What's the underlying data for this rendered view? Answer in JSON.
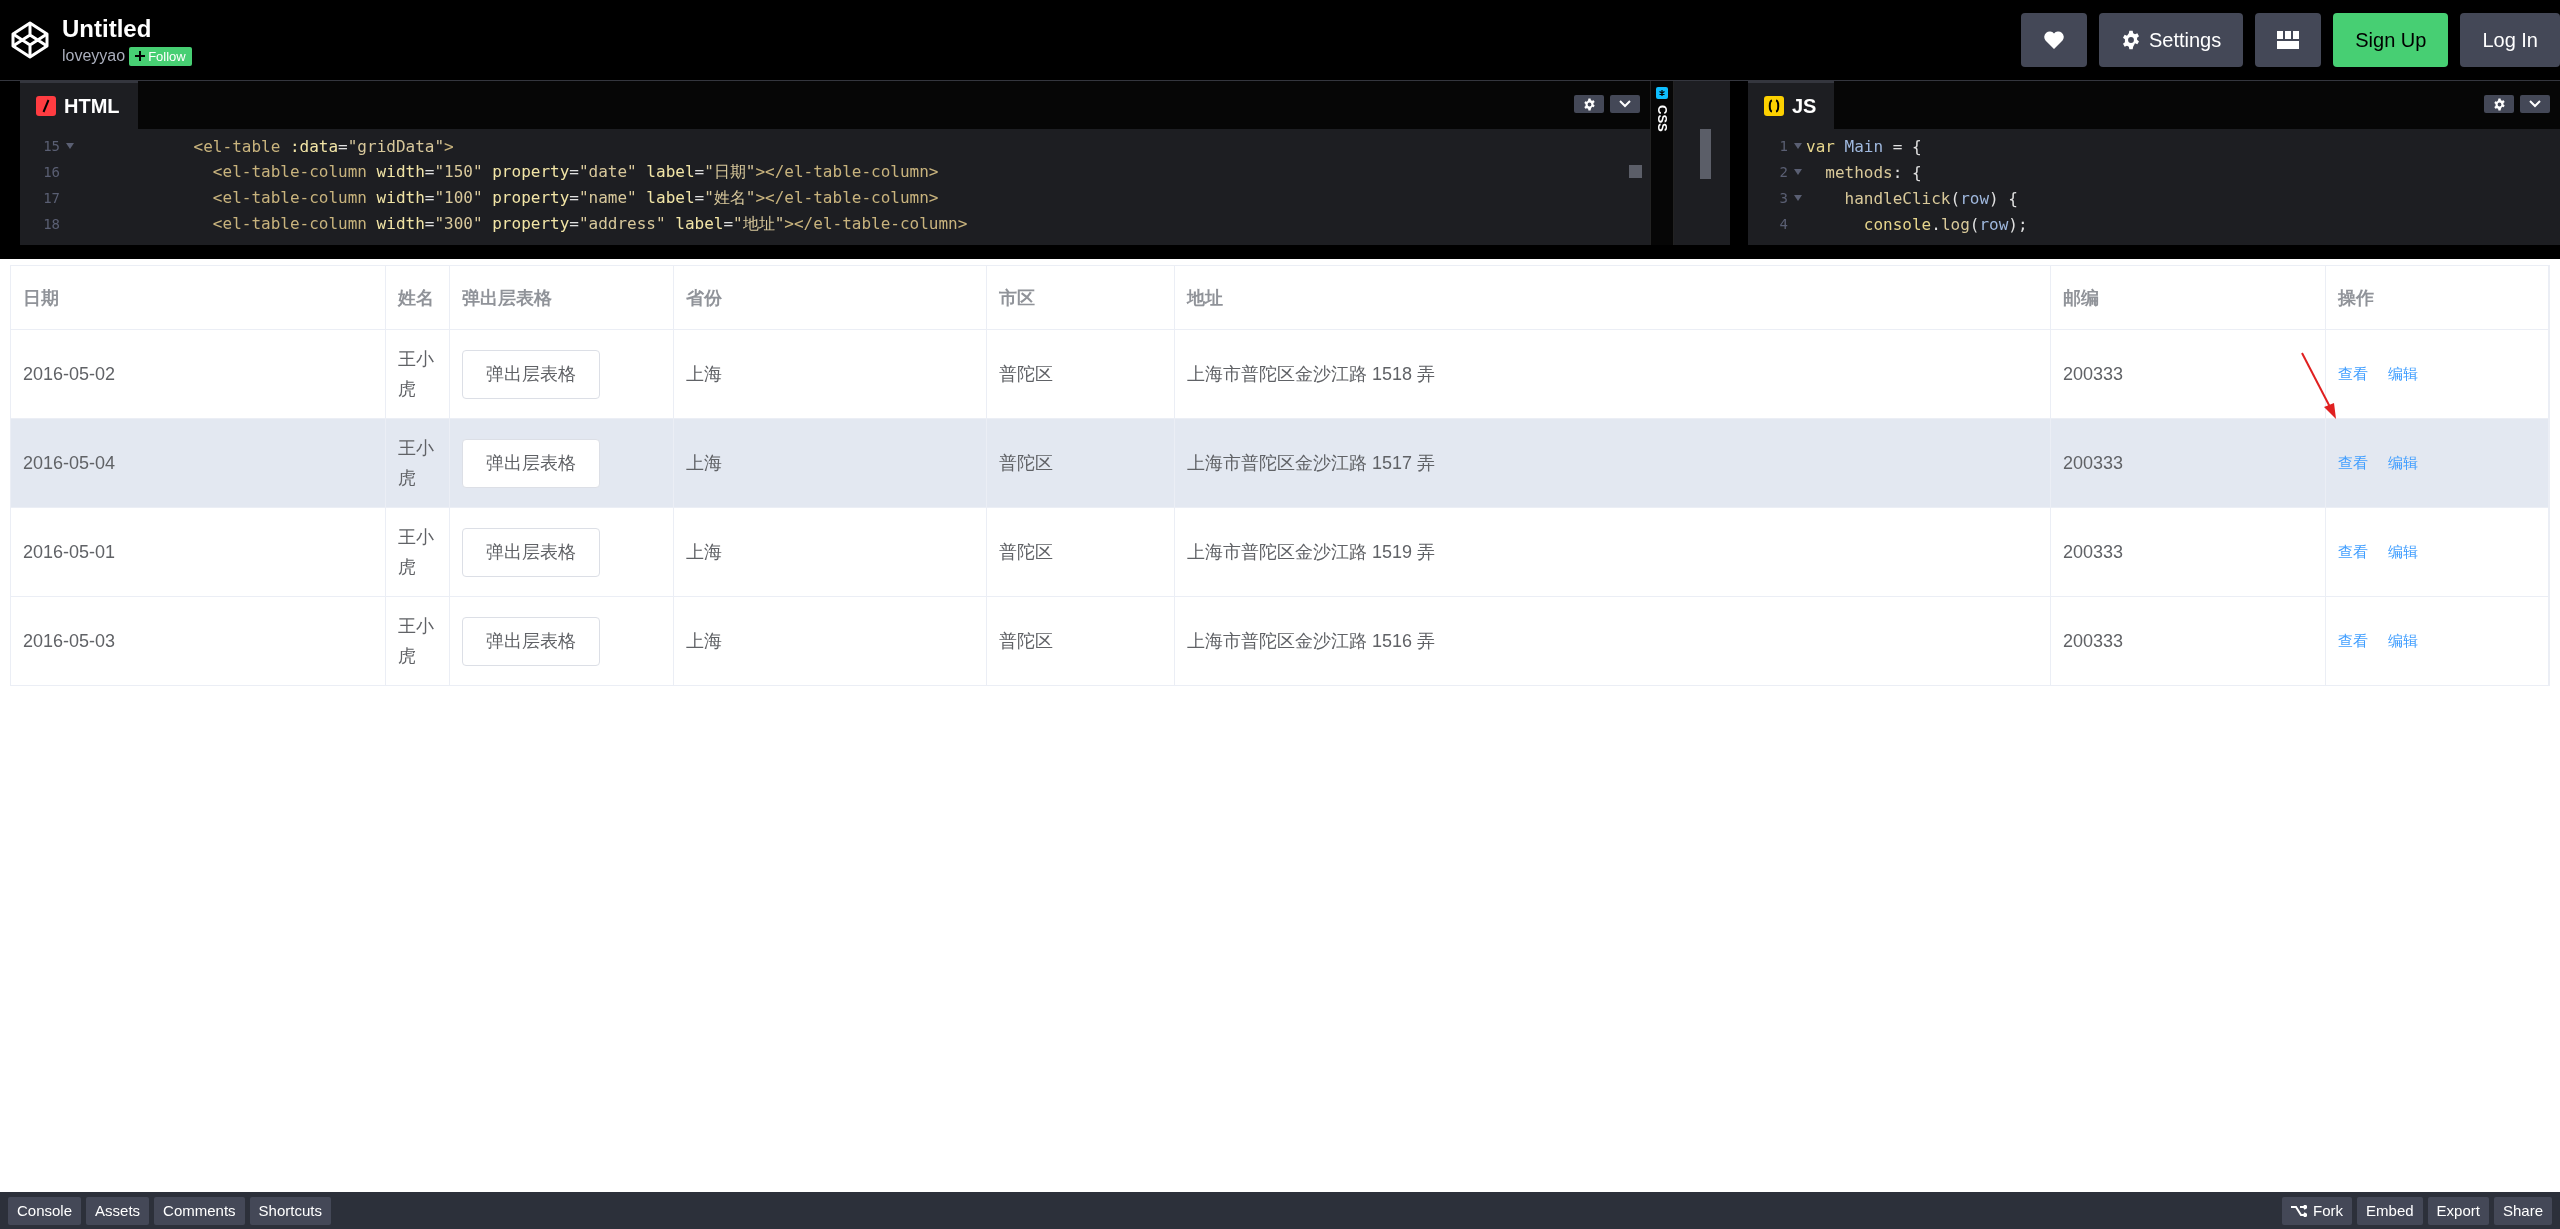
{
  "header": {
    "title": "Untitled",
    "author": "loveyyao",
    "follow_button": "Follow",
    "actions": [
      {
        "kind": "heart"
      },
      {
        "kind": "settings",
        "label": "Settings"
      },
      {
        "kind": "layout"
      },
      {
        "kind": "primary",
        "label": "Sign Up"
      },
      {
        "kind": "plain",
        "label": "Log In"
      }
    ]
  },
  "editors": {
    "html": {
      "tab": "HTML",
      "lines": [
        {
          "number": "15",
          "fold": true,
          "tokens": [
            {
              "kind": "tag",
              "text": "            <el-table"
            },
            {
              "kind": "attr",
              "text": " :data"
            },
            {
              "kind": "plain",
              "text": "="
            },
            {
              "kind": "str",
              "text": "\"gridData\""
            },
            {
              "kind": "tag",
              "text": ">"
            }
          ]
        },
        {
          "number": "16",
          "fold": false,
          "tokens": [
            {
              "kind": "tag",
              "text": "              <el-table-column"
            },
            {
              "kind": "attr",
              "text": " width"
            },
            {
              "kind": "plain",
              "text": "="
            },
            {
              "kind": "str",
              "text": "\"150\""
            },
            {
              "kind": "attr",
              "text": " property"
            },
            {
              "kind": "plain",
              "text": "="
            },
            {
              "kind": "str",
              "text": "\"date\""
            },
            {
              "kind": "attr",
              "text": " label"
            },
            {
              "kind": "plain",
              "text": "="
            },
            {
              "kind": "str",
              "text": "\"日期\""
            },
            {
              "kind": "tag",
              "text": "></el-table-column>"
            }
          ]
        },
        {
          "number": "17",
          "fold": false,
          "tokens": [
            {
              "kind": "tag",
              "text": "              <el-table-column"
            },
            {
              "kind": "attr",
              "text": " width"
            },
            {
              "kind": "plain",
              "text": "="
            },
            {
              "kind": "str",
              "text": "\"100\""
            },
            {
              "kind": "attr",
              "text": " property"
            },
            {
              "kind": "plain",
              "text": "="
            },
            {
              "kind": "str",
              "text": "\"name\""
            },
            {
              "kind": "attr",
              "text": " label"
            },
            {
              "kind": "plain",
              "text": "="
            },
            {
              "kind": "str",
              "text": "\"姓名\""
            },
            {
              "kind": "tag",
              "text": "></el-table-column>"
            }
          ]
        },
        {
          "number": "18",
          "fold": false,
          "tokens": [
            {
              "kind": "tag",
              "text": "              <el-table-column"
            },
            {
              "kind": "attr",
              "text": " width"
            },
            {
              "kind": "plain",
              "text": "="
            },
            {
              "kind": "str",
              "text": "\"300\""
            },
            {
              "kind": "attr",
              "text": " property"
            },
            {
              "kind": "plain",
              "text": "="
            },
            {
              "kind": "str",
              "text": "\"address\""
            },
            {
              "kind": "attr",
              "text": " label"
            },
            {
              "kind": "plain",
              "text": "="
            },
            {
              "kind": "str",
              "text": "\"地址\""
            },
            {
              "kind": "tag",
              "text": "></el-table-column>"
            }
          ]
        }
      ]
    },
    "css": {
      "tab": "CSS"
    },
    "js": {
      "tab": "JS",
      "lines": [
        {
          "number": "1",
          "fold": true,
          "tokens": [
            {
              "kind": "keyword",
              "text": "var"
            },
            {
              "kind": "name",
              "text": " Main"
            },
            {
              "kind": "plain",
              "text": " = {"
            }
          ]
        },
        {
          "number": "2",
          "fold": true,
          "tokens": [
            {
              "kind": "prop",
              "text": "  methods"
            },
            {
              "kind": "plain",
              "text": ": {"
            }
          ]
        },
        {
          "number": "3",
          "fold": true,
          "tokens": [
            {
              "kind": "prop",
              "text": "    handleClick"
            },
            {
              "kind": "plain",
              "text": "("
            },
            {
              "kind": "name",
              "text": "row"
            },
            {
              "kind": "plain",
              "text": ") {"
            }
          ]
        },
        {
          "number": "4",
          "fold": false,
          "tokens": [
            {
              "kind": "keyword",
              "text": "      console"
            },
            {
              "kind": "plain",
              "text": "."
            },
            {
              "kind": "prop",
              "text": "log"
            },
            {
              "kind": "plain",
              "text": "("
            },
            {
              "kind": "name",
              "text": "row"
            },
            {
              "kind": "plain",
              "text": ");"
            }
          ]
        }
      ]
    }
  },
  "table": {
    "columns": [
      "日期",
      "姓名",
      "弹出层表格",
      "省份",
      "市区",
      "地址",
      "邮编",
      "操作"
    ],
    "rows": [
      {
        "date": "2016-05-02",
        "name": "王小虎",
        "popup_button": "弹出层表格",
        "province": "上海",
        "city": "普陀区",
        "address": "上海市普陀区金沙江路 1518 弄",
        "zip": "200333",
        "actions": [
          "查看",
          "编辑"
        ],
        "highlighted": false
      },
      {
        "date": "2016-05-04",
        "name": "王小虎",
        "popup_button": "弹出层表格",
        "province": "上海",
        "city": "普陀区",
        "address": "上海市普陀区金沙江路 1517 弄",
        "zip": "200333",
        "actions": [
          "查看",
          "编辑"
        ],
        "highlighted": true
      },
      {
        "date": "2016-05-01",
        "name": "王小虎",
        "popup_button": "弹出层表格",
        "province": "上海",
        "city": "普陀区",
        "address": "上海市普陀区金沙江路 1519 弄",
        "zip": "200333",
        "actions": [
          "查看",
          "编辑"
        ],
        "highlighted": false
      },
      {
        "date": "2016-05-03",
        "name": "王小虎",
        "popup_button": "弹出层表格",
        "province": "上海",
        "city": "普陀区",
        "address": "上海市普陀区金沙江路 1516 弄",
        "zip": "200333",
        "actions": [
          "查看",
          "编辑"
        ],
        "highlighted": false
      }
    ]
  },
  "footer": {
    "left": [
      "Console",
      "Assets",
      "Comments",
      "Shortcuts"
    ],
    "right": [
      {
        "kind": "fork",
        "label": "Fork"
      },
      {
        "kind": "plain",
        "label": "Embed"
      },
      {
        "kind": "plain",
        "label": "Export"
      },
      {
        "kind": "plain",
        "label": "Share"
      }
    ]
  }
}
